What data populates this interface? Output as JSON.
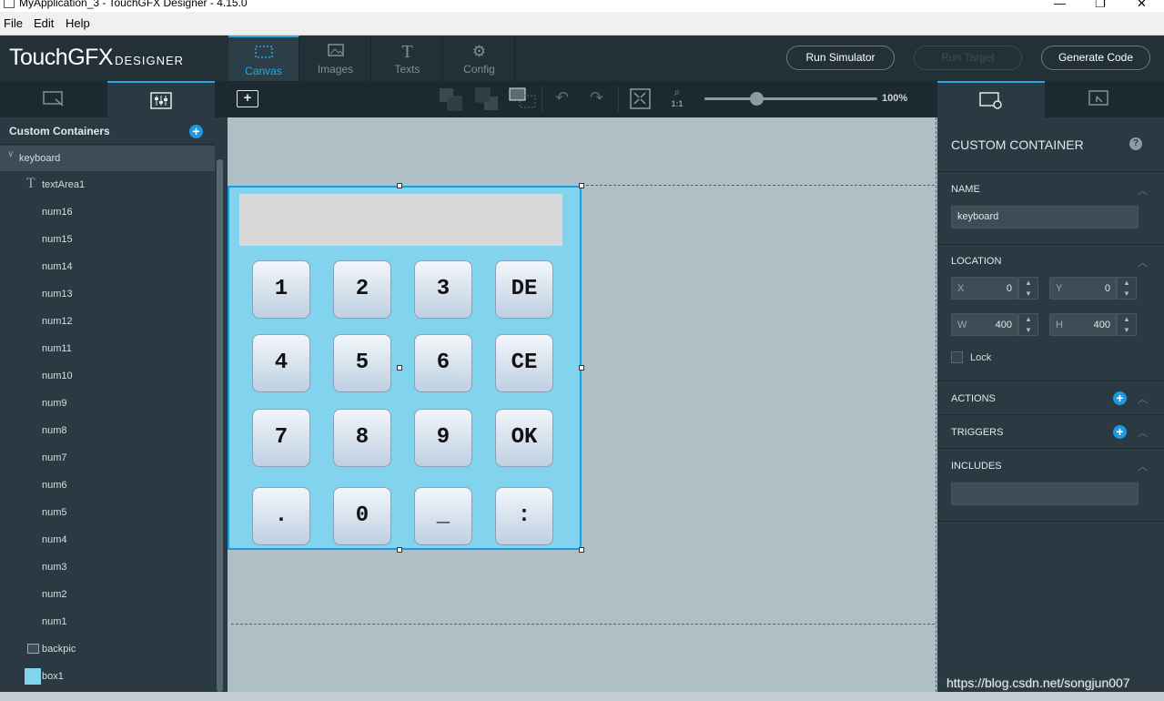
{
  "window": {
    "title": "MyApplication_3 - TouchGFX Designer - 4.15.0",
    "minimize": "—",
    "maximize": "❐",
    "close": "✕"
  },
  "menu": [
    "File",
    "Edit",
    "Help"
  ],
  "header": {
    "logo_main": "TouchGFX",
    "logo_sub": "DESIGNER",
    "tabs": [
      {
        "label": "Canvas",
        "icon": "canvas-icon"
      },
      {
        "label": "Images",
        "icon": "images-icon"
      },
      {
        "label": "Texts",
        "icon": "texts-icon"
      },
      {
        "label": "Config",
        "icon": "config-icon"
      }
    ],
    "buttons": {
      "run_simulator": "Run Simulator",
      "run_target": "Run Target",
      "generate_code": "Generate Code"
    }
  },
  "toolbar": {
    "zoom_label": "100%",
    "zoom_one": "1:1",
    "zoom_fraction": 0.3
  },
  "left_panel": {
    "title": "Custom Containers",
    "tree": [
      {
        "label": "keyboard",
        "type": "container"
      },
      {
        "label": "textArea1",
        "type": "text"
      },
      {
        "label": "num16",
        "type": "button"
      },
      {
        "label": "num15",
        "type": "button"
      },
      {
        "label": "num14",
        "type": "button"
      },
      {
        "label": "num13",
        "type": "button"
      },
      {
        "label": "num12",
        "type": "button"
      },
      {
        "label": "num11",
        "type": "button"
      },
      {
        "label": "num10",
        "type": "button"
      },
      {
        "label": "num9",
        "type": "button"
      },
      {
        "label": "num8",
        "type": "button"
      },
      {
        "label": "num7",
        "type": "button"
      },
      {
        "label": "num6",
        "type": "button"
      },
      {
        "label": "num5",
        "type": "button"
      },
      {
        "label": "num4",
        "type": "button"
      },
      {
        "label": "num3",
        "type": "button"
      },
      {
        "label": "num2",
        "type": "button"
      },
      {
        "label": "num1",
        "type": "button"
      },
      {
        "label": "backpic",
        "type": "image"
      },
      {
        "label": "box1",
        "type": "box"
      }
    ]
  },
  "keypad": {
    "keys": [
      "1",
      "2",
      "3",
      "DE",
      "4",
      "5",
      "6",
      "CE",
      "7",
      "8",
      "9",
      "OK",
      ".",
      "0",
      "_",
      ":"
    ],
    "container_color": "#82d4ee",
    "display_color": "#d8d8d8"
  },
  "right_panel": {
    "title": "CUSTOM CONTAINER",
    "help": "?",
    "name_label": "NAME",
    "name_value": "keyboard",
    "location_label": "LOCATION",
    "x_label": "X",
    "x_value": "0",
    "y_label": "Y",
    "y_value": "0",
    "w_label": "W",
    "w_value": "400",
    "h_label": "H",
    "h_value": "400",
    "lock_label": "Lock",
    "actions_label": "ACTIONS",
    "triggers_label": "TRIGGERS",
    "includes_label": "INCLUDES"
  },
  "watermark": "https://blog.csdn.net/songjun007",
  "colors": {
    "accent": "#2aa9e0",
    "plus": "#1c9be3",
    "selection": "#1c9be3"
  }
}
